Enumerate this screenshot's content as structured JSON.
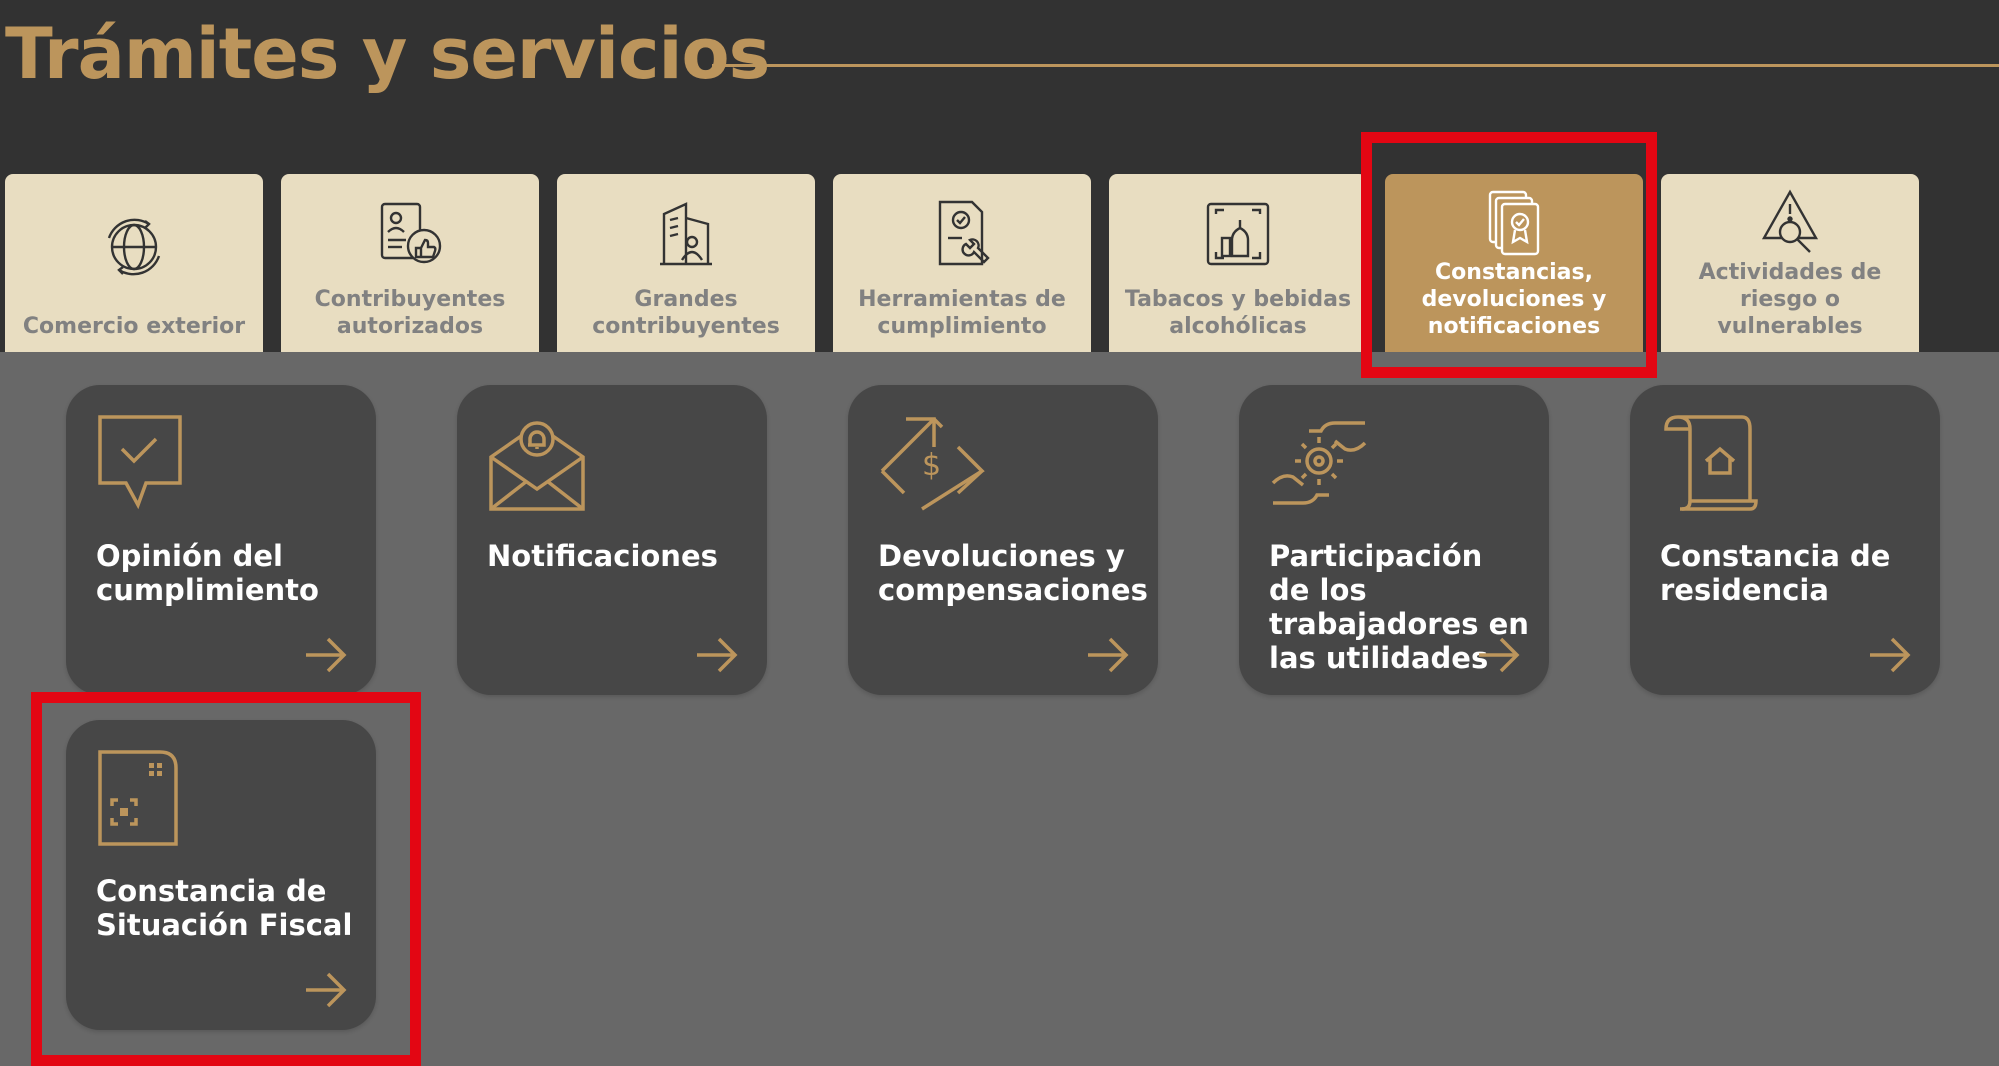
{
  "page_title": "Trámites y servicios",
  "colors": {
    "accent": "#BC955C",
    "tab_bg": "#E8DDC1",
    "card_bg": "#474747",
    "highlight": "#E30613"
  },
  "tabs": [
    {
      "label": "Comercio exterior",
      "icon": "globe-dollar-icon",
      "active": false
    },
    {
      "label": "Contribuyentes autorizados",
      "icon": "document-thumbs-up-icon",
      "active": false
    },
    {
      "label": "Grandes contribuyentes",
      "icon": "building-person-icon",
      "active": false
    },
    {
      "label": "Herramientas de cumplimiento",
      "icon": "document-wrench-icon",
      "active": false
    },
    {
      "label": "Tabacos y bebidas alcohólicas",
      "icon": "bottle-frame-icon",
      "active": false
    },
    {
      "label": "Constancias, devoluciones y notificaciones",
      "icon": "stacked-certificates-icon",
      "active": true
    },
    {
      "label": "Actividades de riesgo o vulnerables",
      "icon": "warning-search-icon",
      "active": false
    }
  ],
  "cards": [
    {
      "title": "Opinión del cumplimiento",
      "icon": "speech-check-icon"
    },
    {
      "title": "Notificaciones",
      "icon": "envelope-bell-icon"
    },
    {
      "title": "Devoluciones y compensaciones",
      "icon": "dollar-exchange-icon"
    },
    {
      "title": "Participación de los trabajadores en las utilidades",
      "icon": "hand-gear-icon"
    },
    {
      "title": "Constancia de residencia",
      "icon": "scroll-house-icon"
    },
    {
      "title": "Constancia de Situación Fiscal",
      "icon": "qr-document-icon"
    }
  ]
}
